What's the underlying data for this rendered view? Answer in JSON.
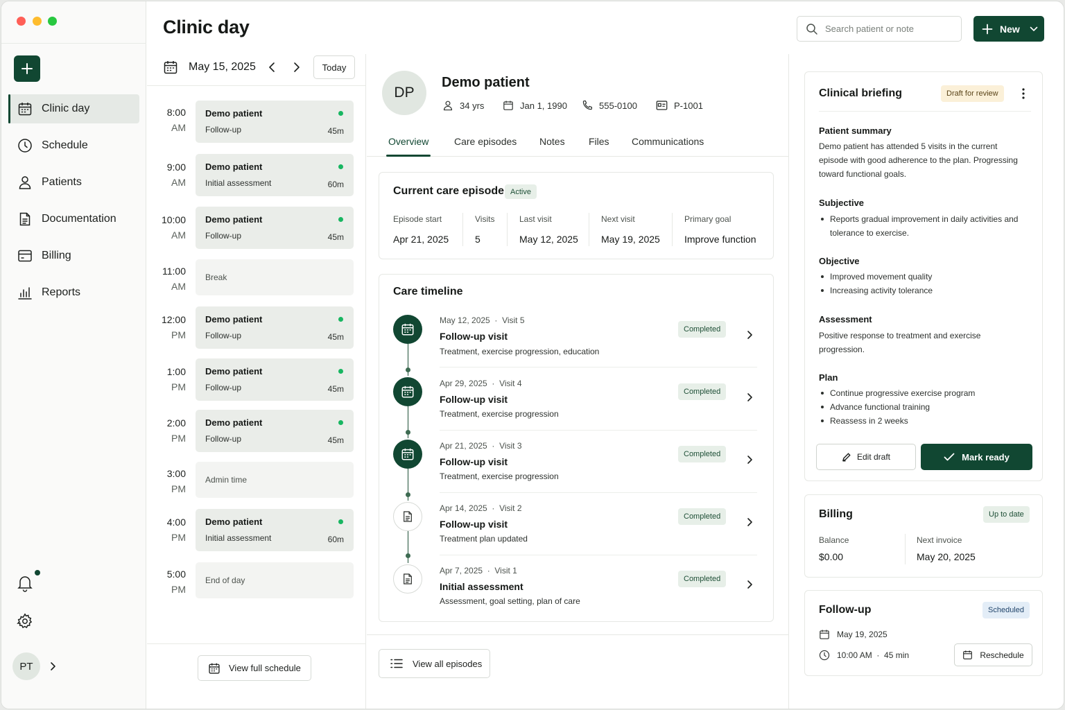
{
  "window": {
    "traffic_lights": [
      "#ff5f57",
      "#febc2e",
      "#28c840"
    ]
  },
  "colors": {
    "brand": "#114732",
    "status_dot": "#18b661"
  },
  "sidebar": {
    "items": [
      {
        "label": "Clinic day",
        "icon": "calendar-icon",
        "active": true
      },
      {
        "label": "Schedule",
        "icon": "clock-icon"
      },
      {
        "label": "Patients",
        "icon": "user-icon"
      },
      {
        "label": "Documentation",
        "icon": "document-icon"
      },
      {
        "label": "Billing",
        "icon": "card-icon"
      },
      {
        "label": "Reports",
        "icon": "bar-chart-icon"
      }
    ],
    "user_initials": "PT"
  },
  "header": {
    "title": "Clinic day",
    "search_placeholder": "Search patient or note",
    "new_label": "New"
  },
  "schedule": {
    "date": "May 15, 2025",
    "today_label": "Today",
    "slots": [
      {
        "time": "8:00",
        "ampm": "AM",
        "kind": "appt",
        "name": "Demo patient",
        "type": "Follow-up",
        "duration": "45m"
      },
      {
        "time": "9:00",
        "ampm": "AM",
        "kind": "appt",
        "name": "Demo patient",
        "type": "Initial assessment",
        "duration": "60m"
      },
      {
        "time": "10:00",
        "ampm": "AM",
        "kind": "appt",
        "name": "Demo patient",
        "type": "Follow-up",
        "duration": "45m"
      },
      {
        "time": "11:00",
        "ampm": "AM",
        "kind": "block",
        "label": "Break"
      },
      {
        "time": "12:00",
        "ampm": "PM",
        "kind": "appt",
        "name": "Demo patient",
        "type": "Follow-up",
        "duration": "45m"
      },
      {
        "time": "1:00",
        "ampm": "PM",
        "kind": "appt",
        "name": "Demo patient",
        "type": "Follow-up",
        "duration": "45m"
      },
      {
        "time": "2:00",
        "ampm": "PM",
        "kind": "appt",
        "name": "Demo patient",
        "type": "Follow-up",
        "duration": "45m"
      },
      {
        "time": "3:00",
        "ampm": "PM",
        "kind": "block",
        "label": "Admin time"
      },
      {
        "time": "4:00",
        "ampm": "PM",
        "kind": "appt",
        "name": "Demo patient",
        "type": "Initial assessment",
        "duration": "60m"
      },
      {
        "time": "5:00",
        "ampm": "PM",
        "kind": "block",
        "label": "End of day"
      }
    ],
    "view_full_label": "View full schedule"
  },
  "patient": {
    "initials": "DP",
    "name": "Demo patient",
    "age": "34 yrs",
    "dob": "Jan 1, 1990",
    "phone": "555-0100",
    "id": "P-1001",
    "tabs": [
      "Overview",
      "Care episodes",
      "Notes",
      "Files",
      "Communications"
    ],
    "active_tab": "Overview"
  },
  "episode": {
    "title": "Current care episode",
    "status": "Active",
    "fields": [
      {
        "label": "Episode start",
        "value": "Apr 21, 2025"
      },
      {
        "label": "Visits",
        "value": "5"
      },
      {
        "label": "Last visit",
        "value": "May 12, 2025"
      },
      {
        "label": "Next visit",
        "value": "May 19, 2025"
      },
      {
        "label": "Primary goal",
        "value": "Improve function"
      }
    ]
  },
  "timeline": {
    "title": "Care timeline",
    "items": [
      {
        "date": "May 12, 2025",
        "visit": "Visit 5",
        "title": "Follow-up visit",
        "desc": "Treatment, exercise progression, education",
        "status": "Completed",
        "icon": "calendar-icon"
      },
      {
        "date": "Apr 29, 2025",
        "visit": "Visit 4",
        "title": "Follow-up visit",
        "desc": "Treatment, exercise progression",
        "status": "Completed",
        "icon": "calendar-icon"
      },
      {
        "date": "Apr 21, 2025",
        "visit": "Visit 3",
        "title": "Follow-up visit",
        "desc": "Treatment, exercise progression",
        "status": "Completed",
        "icon": "calendar-icon"
      },
      {
        "date": "Apr 14, 2025",
        "visit": "Visit 2",
        "title": "Follow-up visit",
        "desc": "Treatment plan updated",
        "status": "Completed",
        "icon": "document-icon"
      },
      {
        "date": "Apr 7, 2025",
        "visit": "Visit 1",
        "title": "Initial assessment",
        "desc": "Assessment, goal setting, plan of care",
        "status": "Completed",
        "icon": "document-icon"
      }
    ],
    "view_all_label": "View all episodes"
  },
  "briefing": {
    "title": "Clinical briefing",
    "status": "Draft for review",
    "summary_title": "Patient summary",
    "summary": "Demo patient has attended 5 visits in the current episode with good adherence to the plan. Progressing toward functional goals.",
    "subjective_title": "Subjective",
    "subjective": [
      "Reports gradual improvement in daily activities and tolerance to exercise."
    ],
    "objective_title": "Objective",
    "objective": [
      "Improved movement quality",
      "Increasing activity tolerance"
    ],
    "assessment_title": "Assessment",
    "assessment": "Positive response to treatment and exercise progression.",
    "plan_title": "Plan",
    "plan": [
      "Continue progressive exercise program",
      "Advance functional training",
      "Reassess in 2 weeks"
    ],
    "edit_label": "Edit draft",
    "ready_label": "Mark ready"
  },
  "billing": {
    "title": "Billing",
    "status": "Up to date",
    "balance_label": "Balance",
    "balance": "$0.00",
    "invoice_label": "Next invoice",
    "invoice": "May 20, 2025"
  },
  "followup": {
    "title": "Follow-up",
    "status": "Scheduled",
    "date": "May 19, 2025",
    "time": "10:00 AM",
    "duration": "45 min",
    "reschedule_label": "Reschedule"
  }
}
